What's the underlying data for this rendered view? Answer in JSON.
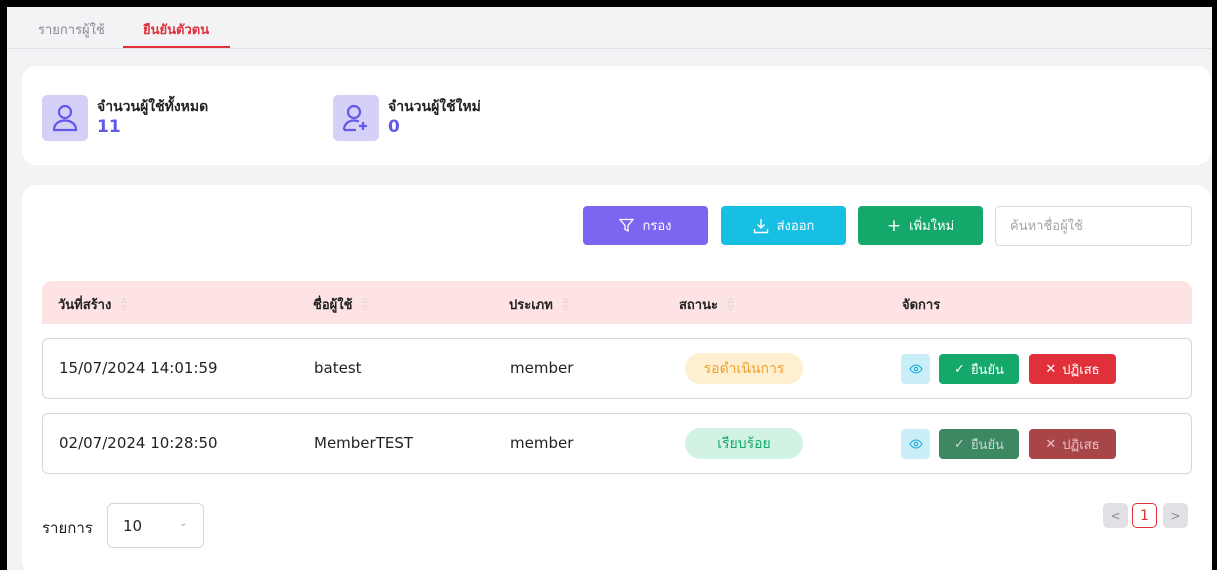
{
  "tabs": [
    {
      "label": "รายการผู้ใช้",
      "active": false
    },
    {
      "label": "ยืนยันตัวตน",
      "active": true
    }
  ],
  "stats": {
    "total_label": "จำนวนผู้ใช้ทั้งหมด",
    "total_value": "11",
    "new_label": "จำนวนผู้ใช้ใหม่",
    "new_value": "0"
  },
  "toolbar": {
    "filter_label": "กรอง",
    "export_label": "ส่งออก",
    "add_label": "เพิ่มใหม่",
    "search_placeholder": "ค้นหาชื่อผู้ใช้"
  },
  "table": {
    "columns": [
      "วันที่สร้าง",
      "ชื่อผู้ใช้",
      "ประเภท",
      "สถานะ",
      "จัดการ"
    ],
    "rows": [
      {
        "created": "15/07/2024 14:01:59",
        "username": "batest",
        "type": "member",
        "status": "รอดำเนินการ"
      },
      {
        "created": "02/07/2024 10:28:50",
        "username": "MemberTEST",
        "type": "member",
        "status": "เรียบร้อย"
      }
    ],
    "confirm_label": "ยืนยัน",
    "reject_label": "ปฏิเสธ"
  },
  "footer": {
    "rows_label": "รายการ",
    "rows_value": "10",
    "current_page": "1"
  },
  "colors": {
    "accent_red": "#e0303a",
    "primary_purple": "#6359e9",
    "filter": "#7c66f1",
    "export": "#18bfe5",
    "add": "#14a86a"
  },
  "icons": [
    "user-icon",
    "user-plus-icon",
    "filter-icon",
    "download-icon",
    "plus-icon",
    "eye-icon",
    "check-icon",
    "x-icon",
    "chevron-left-icon",
    "chevron-right-icon",
    "chevron-down-icon",
    "sort-icon"
  ]
}
